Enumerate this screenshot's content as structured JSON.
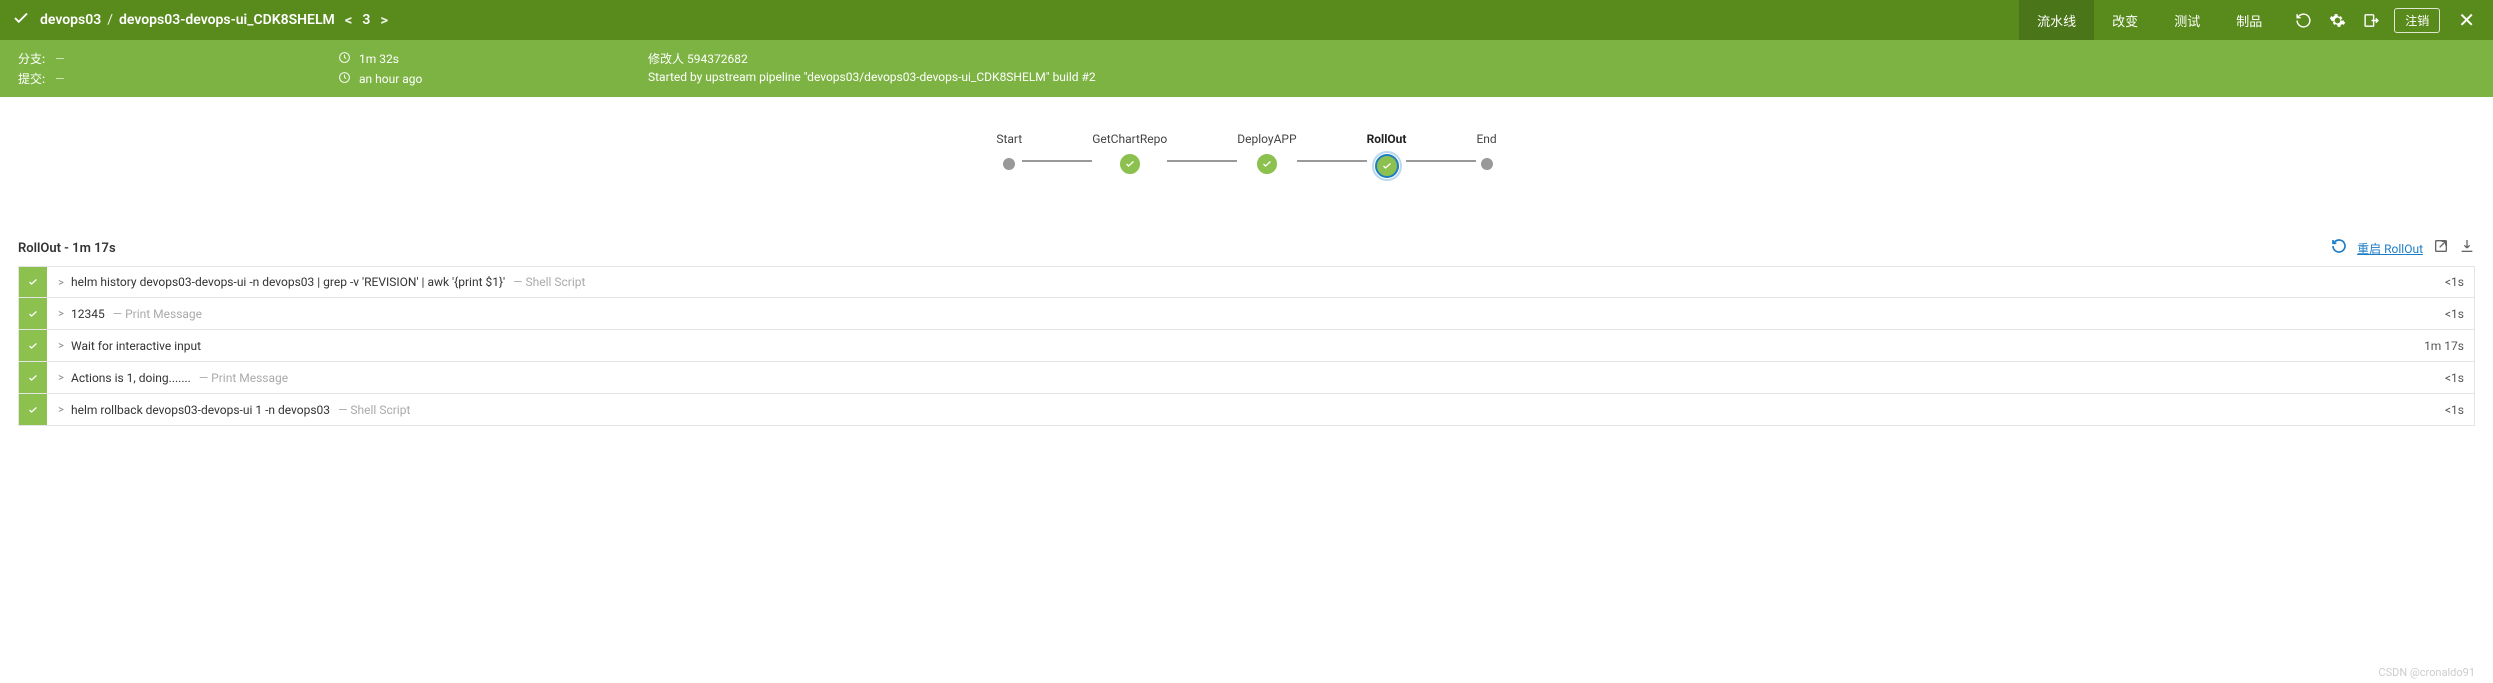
{
  "header": {
    "breadcrumb_org": "devops03",
    "breadcrumb_pipeline": "devops03-devops-ui_CDK8SHELM",
    "breadcrumb_run": "3",
    "tabs": [
      "流水线",
      "改变",
      "测试",
      "制品"
    ],
    "active_tab": 0,
    "logout": "注销"
  },
  "meta": {
    "branch_label": "分支:",
    "branch_value": "—",
    "commit_label": "提交:",
    "commit_value": "—",
    "duration": "1m 32s",
    "time": "an hour ago",
    "author_label": "修改人",
    "author_value": "594372682",
    "trigger": "Started by upstream pipeline \"devops03/devops03-devops-ui_CDK8SHELM\" build #2"
  },
  "pipeline": {
    "stages": [
      "Start",
      "GetChartRepo",
      "DeployAPP",
      "RollOut",
      "End"
    ],
    "active_index": 3
  },
  "stage_header": {
    "title": "RollOut - 1m 17s",
    "restart": "重启 RollOut"
  },
  "steps": [
    {
      "cmd": "helm history devops03-devops-ui -n devops03 | grep -v 'REVISION' | awk '{print $1}'",
      "meta": "— Shell Script",
      "dur": "<1s"
    },
    {
      "cmd": "12345",
      "meta": "— Print Message",
      "dur": "<1s"
    },
    {
      "cmd": "Wait for interactive input",
      "meta": "",
      "dur": "1m 17s"
    },
    {
      "cmd": "Actions is 1, doing.......",
      "meta": "— Print Message",
      "dur": "<1s"
    },
    {
      "cmd": "helm rollback devops03-devops-ui 1 -n devops03",
      "meta": "— Shell Script",
      "dur": "<1s"
    }
  ],
  "watermark": "CSDN @cronaldo91"
}
